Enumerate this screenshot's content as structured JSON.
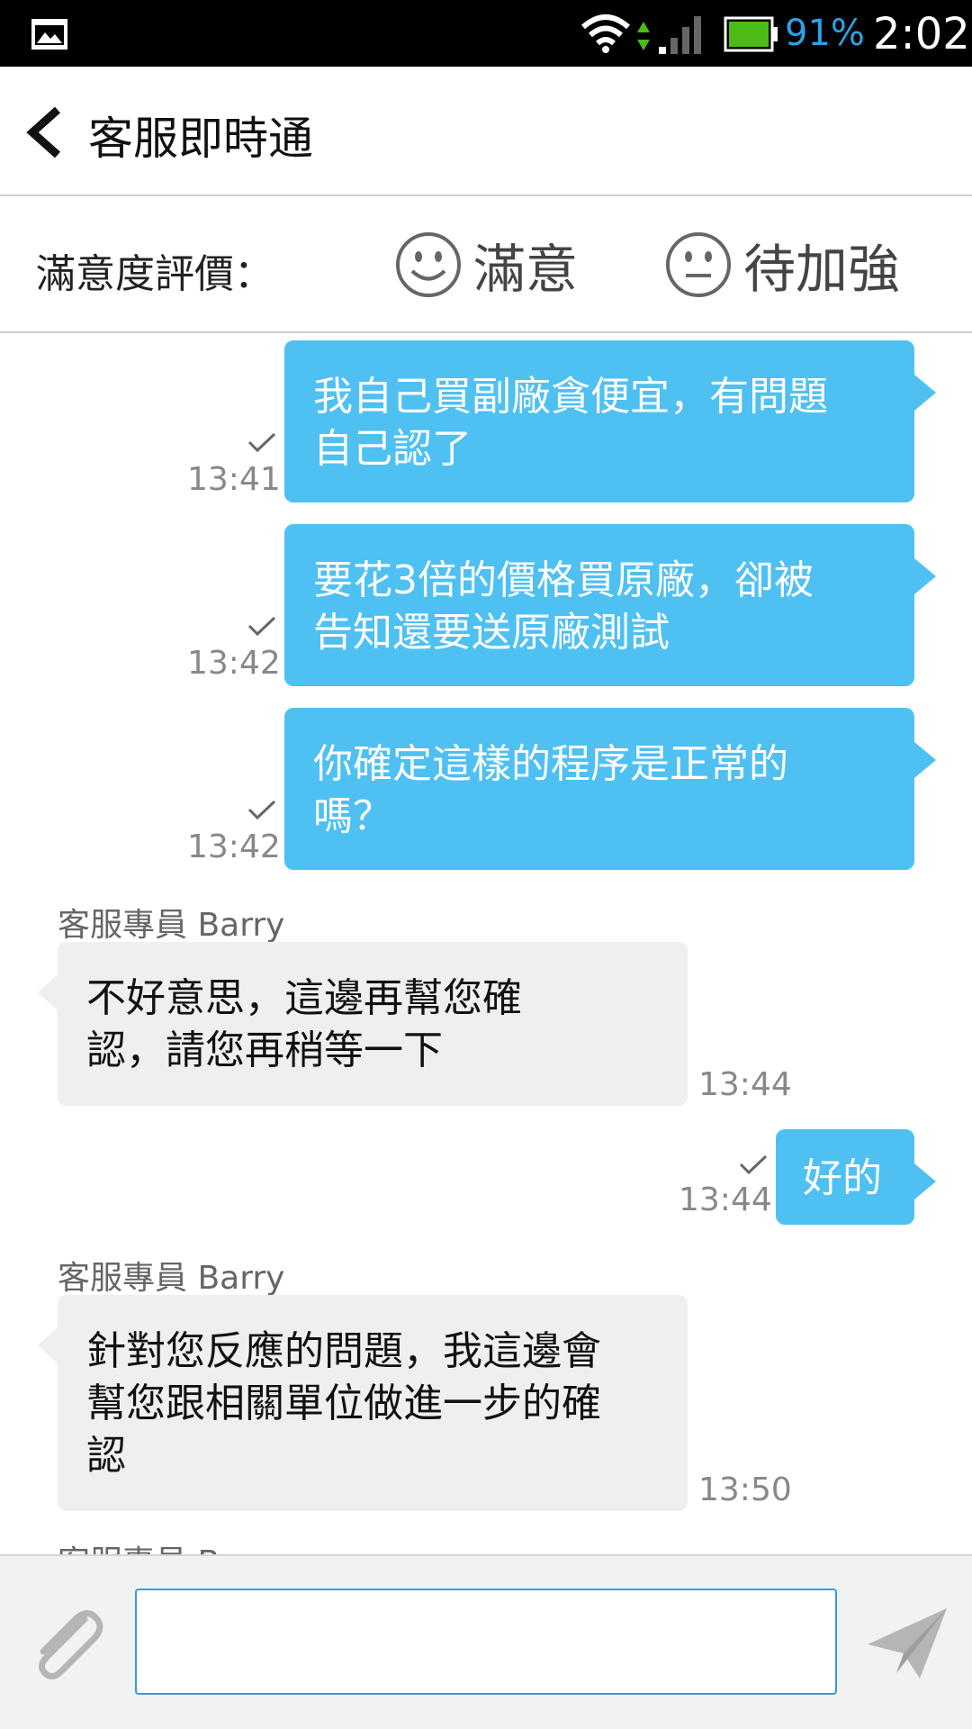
{
  "status_bar": {
    "battery_percent": "91%",
    "time": "2:02",
    "battery_color": "#4cbb17",
    "percent_color": "#2aa3e6"
  },
  "header": {
    "title": "客服即時通"
  },
  "rating": {
    "label": "滿意度評價：",
    "good_label": "滿意",
    "improve_label": "待加強"
  },
  "messages": [
    {
      "direction": "out",
      "lines": [
        "我自己買副廠貪便宜，有問題",
        "自己認了"
      ],
      "time": "13:41"
    },
    {
      "direction": "out",
      "lines": [
        "要花3倍的價格買原廠，卻被",
        "告知還要送原廠測試"
      ],
      "time": "13:42"
    },
    {
      "direction": "out",
      "lines": [
        "你確定這樣的程序是正常的",
        "嗎？"
      ],
      "time": "13:42"
    },
    {
      "direction": "in",
      "sender": "客服專員 Barry",
      "lines": [
        "不好意思，這邊再幫您確",
        "認，請您再稍等一下"
      ],
      "time": "13:44"
    },
    {
      "direction": "out",
      "lines": [
        "好的"
      ],
      "time": "13:44"
    },
    {
      "direction": "in",
      "sender": "客服專員 Barry",
      "lines": [
        "針對您反應的問題，我這邊會",
        "幫您跟相關單位做進一步的確",
        "認"
      ],
      "time": "13:50"
    },
    {
      "direction": "in",
      "sender": "客服專員 Barry",
      "lines": [],
      "time": ""
    }
  ],
  "input": {
    "placeholder": ""
  },
  "colors": {
    "outgoing_bubble": "#4fc0f2",
    "incoming_bubble": "#efefef",
    "input_border": "#3a9bdc"
  }
}
